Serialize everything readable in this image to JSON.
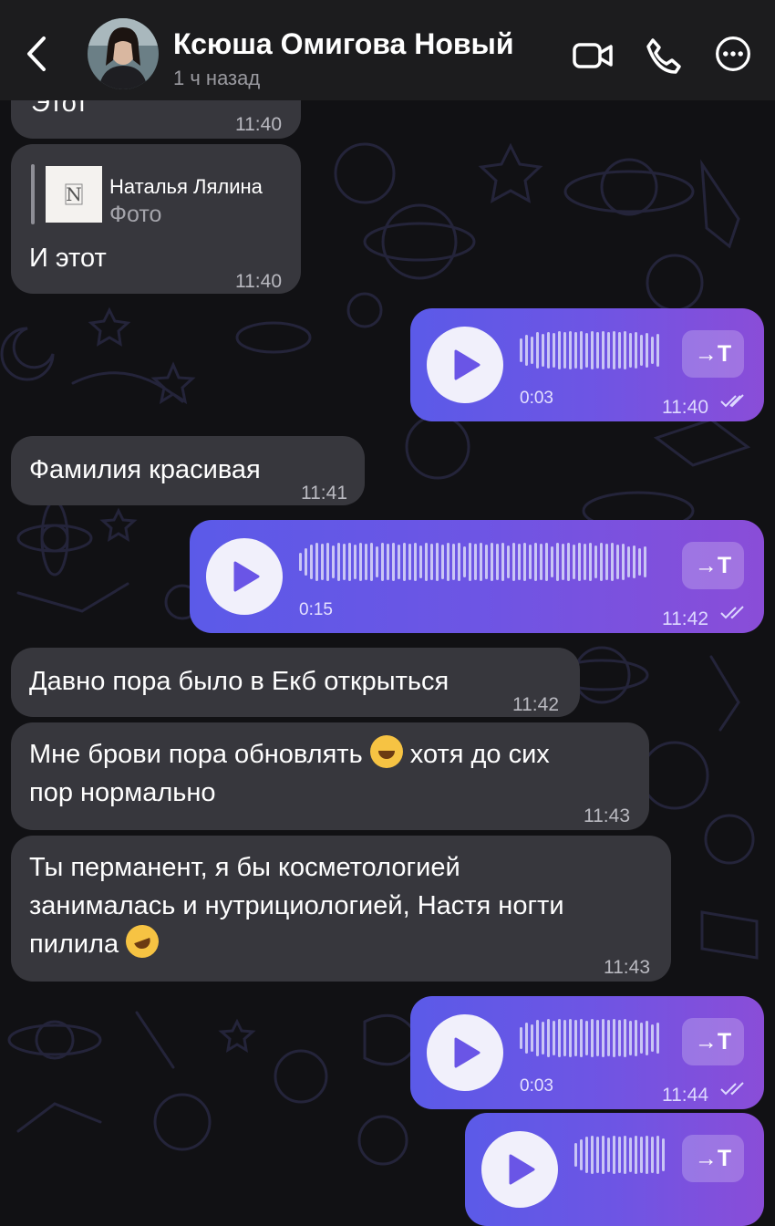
{
  "header": {
    "contact_name": "Ксюша Омигова Новый",
    "status": "1 ч назад"
  },
  "messages": [
    {
      "type": "text",
      "direction": "in",
      "text": "Этот",
      "time": "11:40"
    },
    {
      "type": "reply",
      "direction": "in",
      "reply_author": "Наталья Лялина",
      "reply_kind": "Фото",
      "text": "И этот",
      "time": "11:40"
    },
    {
      "type": "voice",
      "direction": "out",
      "duration": "0:03",
      "time": "11:40",
      "transcribe_label": "→T"
    },
    {
      "type": "text",
      "direction": "in",
      "text": "Фамилия красивая",
      "time": "11:41"
    },
    {
      "type": "voice",
      "direction": "out",
      "duration": "0:15",
      "time": "11:42",
      "transcribe_label": "→T"
    },
    {
      "type": "text",
      "direction": "in",
      "text": "Давно пора было в Екб открыться",
      "time": "11:42"
    },
    {
      "type": "text",
      "direction": "in",
      "line1": "Мне брови пора обновлять",
      "line1b": "хотя до сих",
      "line2": "пор нормально",
      "emoji": "face-with-tears-of-joy",
      "time": "11:43"
    },
    {
      "type": "text",
      "direction": "in",
      "line1": "Ты перманент, я бы косметологией",
      "line2": "занималась и нутрициологией, Настя ногти",
      "line3": "пилила",
      "emoji": "rolling-on-floor-laughing",
      "time": "11:43"
    },
    {
      "type": "voice",
      "direction": "out",
      "duration": "0:03",
      "time": "11:44",
      "transcribe_label": "→T"
    },
    {
      "type": "voice",
      "direction": "out",
      "partial": true,
      "transcribe_label": "→T"
    }
  ],
  "colors": {
    "background": "#111114",
    "header": "#1c1c1e",
    "incoming": "#37373d",
    "outgoing_start": "#5b5ae8",
    "outgoing_end": "#8a4dd8"
  }
}
